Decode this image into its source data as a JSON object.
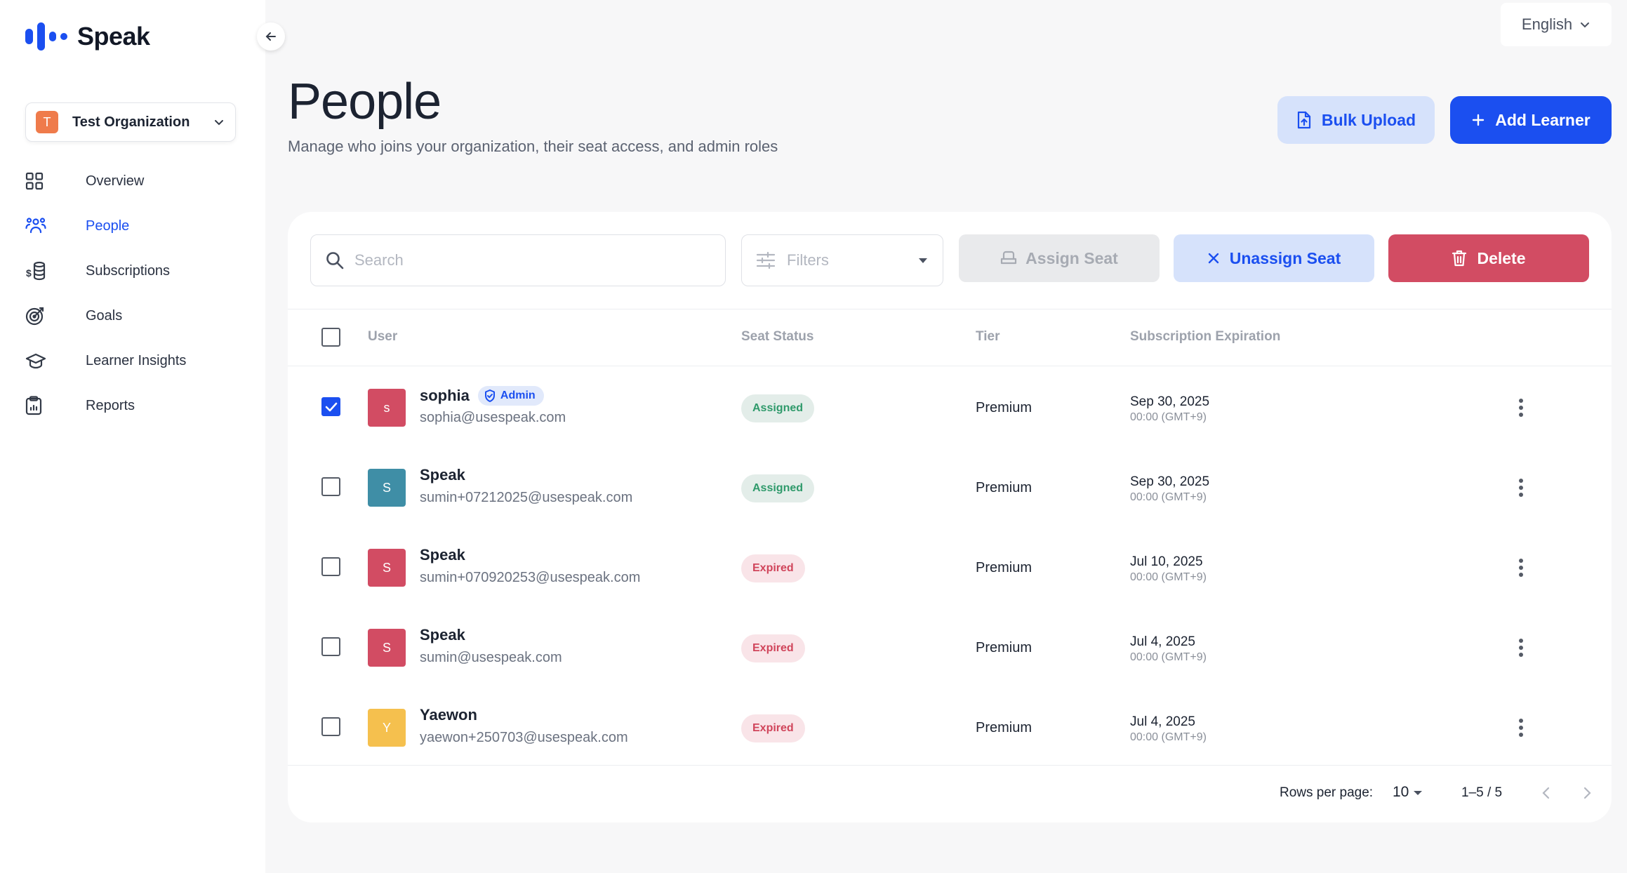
{
  "app": {
    "name": "Speak"
  },
  "language": {
    "selected": "English"
  },
  "organization": {
    "initial": "T",
    "name": "Test Organization"
  },
  "sidebar": {
    "items": [
      {
        "label": "Overview",
        "icon": "grid-icon",
        "active": false
      },
      {
        "label": "People",
        "icon": "people-icon",
        "active": true
      },
      {
        "label": "Subscriptions",
        "icon": "coins-icon",
        "active": false
      },
      {
        "label": "Goals",
        "icon": "target-icon",
        "active": false
      },
      {
        "label": "Learner Insights",
        "icon": "graduation-cap-icon",
        "active": false
      },
      {
        "label": "Reports",
        "icon": "clipboard-icon",
        "active": false
      }
    ]
  },
  "page": {
    "title": "People",
    "subtitle": "Manage who joins your organization, their seat access, and admin roles"
  },
  "actions": {
    "bulk_upload": "Bulk Upload",
    "add_learner": "Add Learner",
    "assign_seat": "Assign Seat",
    "unassign_seat": "Unassign Seat",
    "delete": "Delete"
  },
  "toolbar": {
    "search_placeholder": "Search",
    "filters_placeholder": "Filters"
  },
  "table": {
    "headers": {
      "user": "User",
      "seat_status": "Seat Status",
      "tier": "Tier",
      "expiration": "Subscription Expiration"
    },
    "rows": [
      {
        "initial": "s",
        "avatar_color": "#d24c63",
        "name": "sophia",
        "admin": true,
        "admin_label": "Admin",
        "email": "sophia@usespeak.com",
        "status": "Assigned",
        "tier": "Premium",
        "exp_date": "Sep 30, 2025",
        "exp_time": "00:00 (GMT+9)",
        "checked": true
      },
      {
        "initial": "S",
        "avatar_color": "#3f8ea6",
        "name": "Speak",
        "admin": false,
        "email": "sumin+07212025@usespeak.com",
        "status": "Assigned",
        "tier": "Premium",
        "exp_date": "Sep 30, 2025",
        "exp_time": "00:00 (GMT+9)",
        "checked": false
      },
      {
        "initial": "S",
        "avatar_color": "#d24c63",
        "name": "Speak",
        "admin": false,
        "email": "sumin+070920253@usespeak.com",
        "status": "Expired",
        "tier": "Premium",
        "exp_date": "Jul 10, 2025",
        "exp_time": "00:00 (GMT+9)",
        "checked": false
      },
      {
        "initial": "S",
        "avatar_color": "#d24c63",
        "name": "Speak",
        "admin": false,
        "email": "sumin@usespeak.com",
        "status": "Expired",
        "tier": "Premium",
        "exp_date": "Jul 4, 2025",
        "exp_time": "00:00 (GMT+9)",
        "checked": false
      },
      {
        "initial": "Y",
        "avatar_color": "#f5c04e",
        "name": "Yaewon",
        "admin": false,
        "email": "yaewon+250703@usespeak.com",
        "status": "Expired",
        "tier": "Premium",
        "exp_date": "Jul 4, 2025",
        "exp_time": "00:00 (GMT+9)",
        "checked": false
      }
    ]
  },
  "pagination": {
    "rows_per_page_label": "Rows per page:",
    "rows_per_page": "10",
    "range": "1–5 / 5"
  },
  "colors": {
    "accent": "#1b4ff0",
    "danger": "#d24c63",
    "assigned": "#2f9a6b",
    "expired": "#d0455b"
  }
}
